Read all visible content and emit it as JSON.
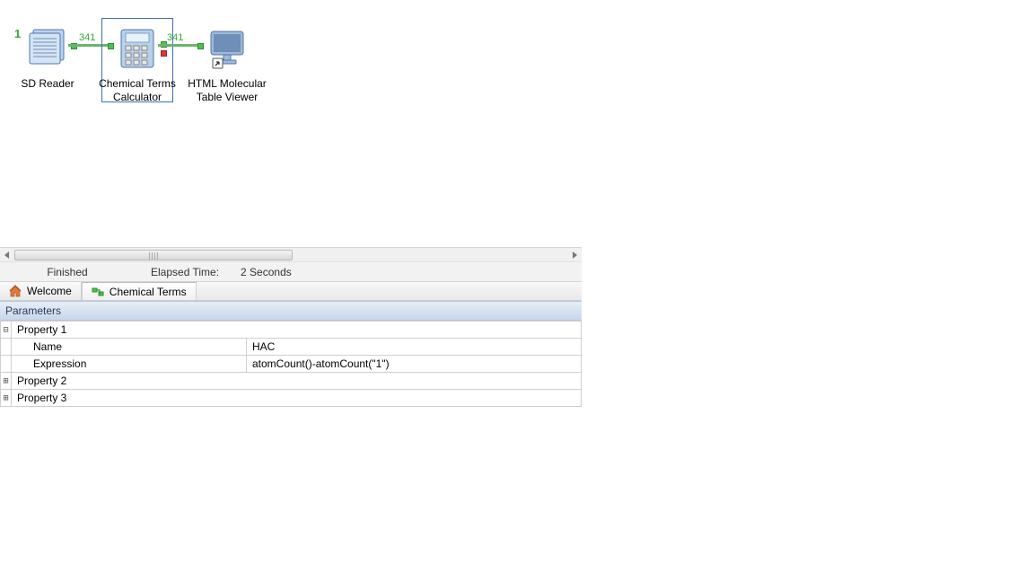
{
  "annotation": "1",
  "nodes": {
    "sd_reader": {
      "label": "SD Reader"
    },
    "chem_calc": {
      "label": "Chemical Terms Calculator"
    },
    "html_viewer": {
      "label": "HTML Molecular Table Viewer"
    }
  },
  "wire_count_1": "341",
  "wire_count_2": "341",
  "status": {
    "state": "Finished",
    "elapsed_label": "Elapsed Time:",
    "elapsed_value": "2 Seconds"
  },
  "tabs": {
    "welcome": "Welcome",
    "chemterms": "Chemical Terms"
  },
  "panel_title": "Parameters",
  "params": {
    "p1": {
      "title": "Property 1",
      "name_key": "Name",
      "name_val": "HAC",
      "expr_key": "Expression",
      "expr_val": "atomCount()-atomCount(\"1\")"
    },
    "p2": {
      "title": "Property 2"
    },
    "p3": {
      "title": "Property 3"
    }
  },
  "expander": {
    "minus": "⊟",
    "plus": "⊞"
  }
}
